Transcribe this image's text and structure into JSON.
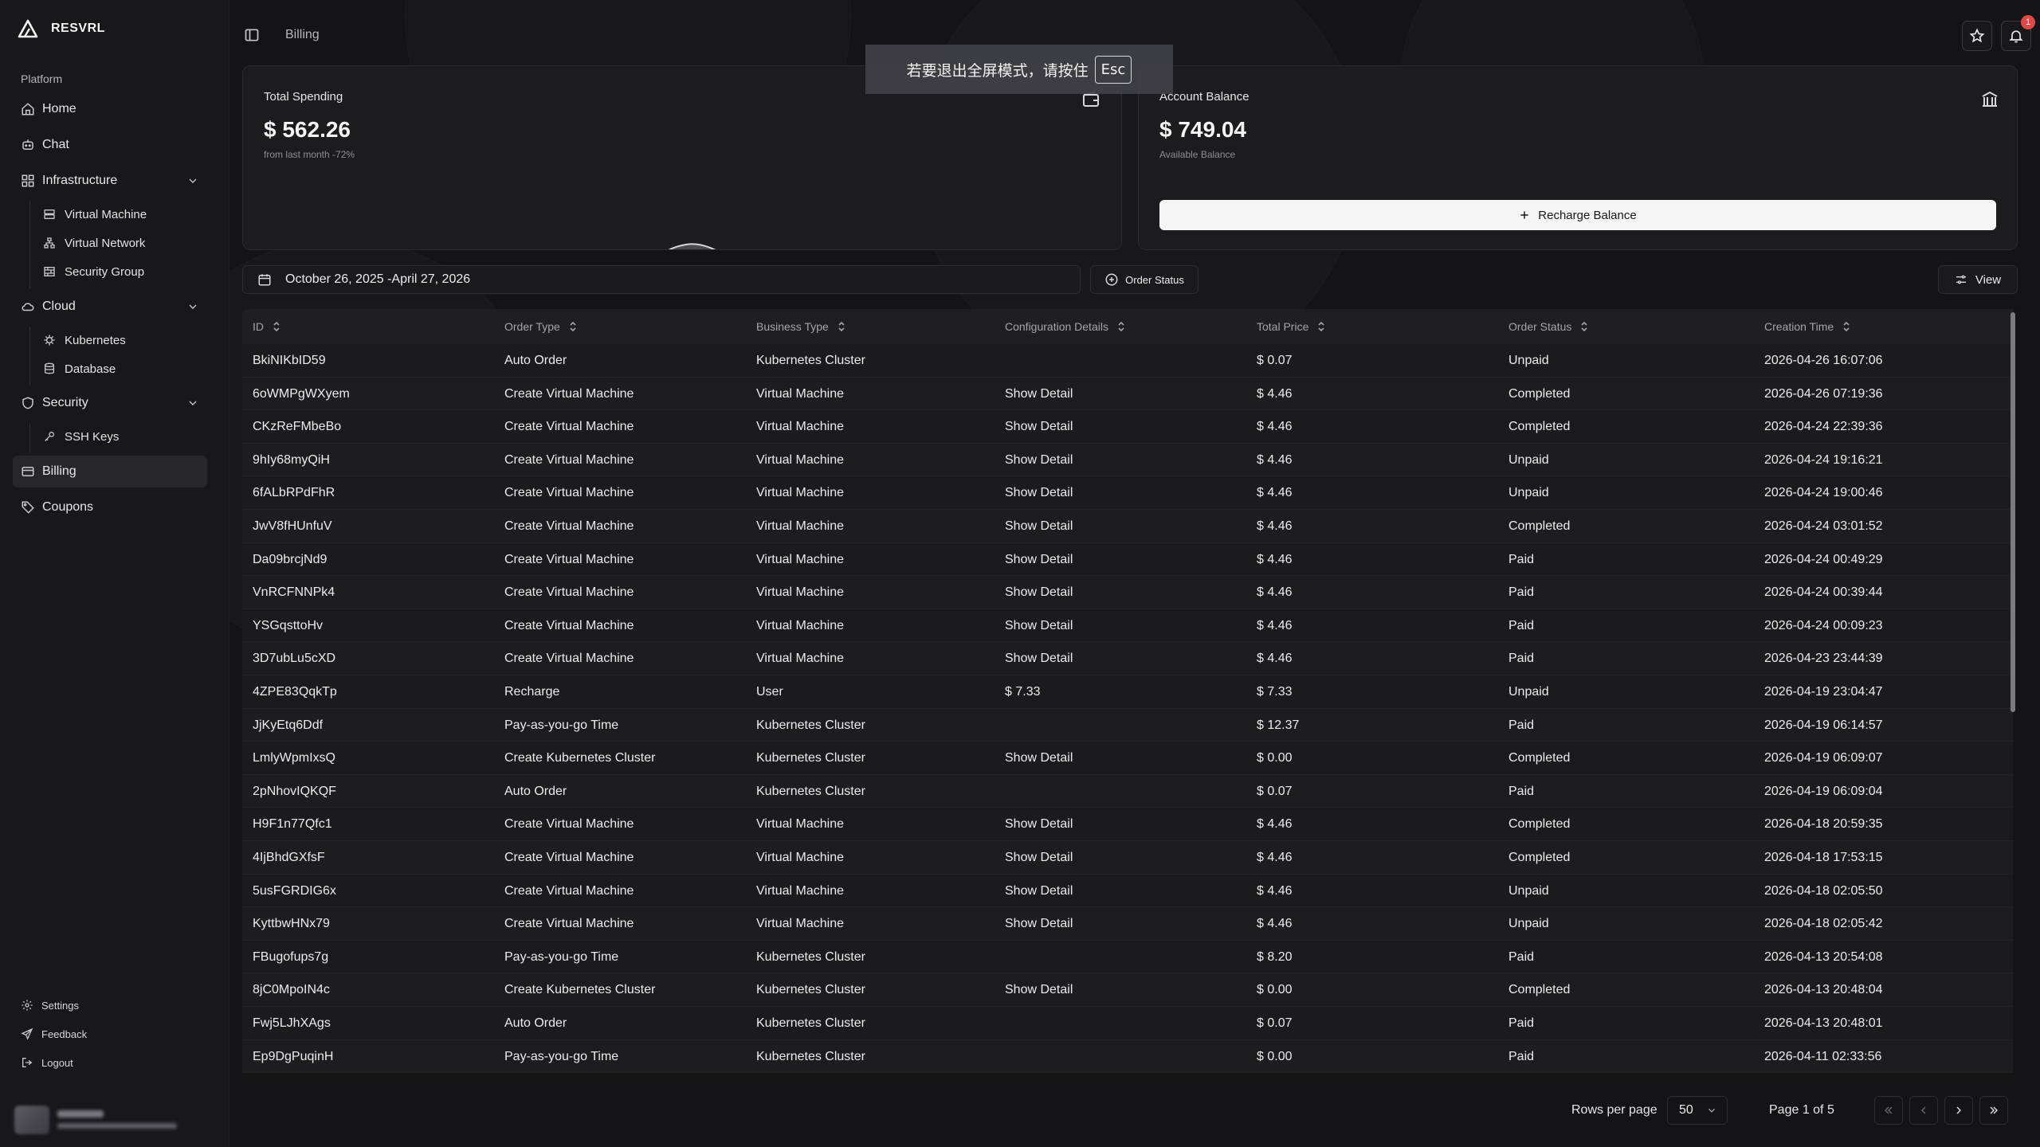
{
  "brand": {
    "name": "RESVRL"
  },
  "sidebar": {
    "section_label": "Platform",
    "home": "Home",
    "chat": "Chat",
    "infrastructure": {
      "label": "Infrastructure",
      "items": [
        "Virtual Machine",
        "Virtual Network",
        "Security Group"
      ]
    },
    "cloud": {
      "label": "Cloud",
      "items": [
        "Kubernetes",
        "Database"
      ]
    },
    "security": {
      "label": "Security",
      "items": [
        "SSH Keys"
      ]
    },
    "billing": "Billing",
    "coupons": "Coupons",
    "footer": {
      "settings": "Settings",
      "feedback": "Feedback",
      "logout": "Logout"
    }
  },
  "header": {
    "breadcrumb": "Billing",
    "notification_count": "1"
  },
  "fullscreen_toast": {
    "text": "若要退出全屏模式，请按住",
    "key": "Esc"
  },
  "total_spending": {
    "title": "Total Spending",
    "value": "$ 562.26",
    "sub": "from last month -72%"
  },
  "account_balance": {
    "title": "Account Balance",
    "value": "$ 749.04",
    "sub": "Available Balance",
    "recharge_label": "Recharge Balance"
  },
  "filters": {
    "date_range": "October 26, 2025 -April 27, 2026",
    "order_status": "Order Status",
    "view": "View"
  },
  "table": {
    "columns": [
      "ID",
      "Order Type",
      "Business Type",
      "Configuration Details",
      "Total Price",
      "Order Status",
      "Creation Time"
    ],
    "rows": [
      [
        "BkiNIKbID59",
        "Auto Order",
        "Kubernetes Cluster",
        "",
        "$ 0.07",
        "Unpaid",
        "2026-04-26 16:07:06"
      ],
      [
        "6oWMPgWXyem",
        "Create Virtual Machine",
        "Virtual Machine",
        "Show Detail",
        "$ 4.46",
        "Completed",
        "2026-04-26 07:19:36"
      ],
      [
        "CKzReFMbeBo",
        "Create Virtual Machine",
        "Virtual Machine",
        "Show Detail",
        "$ 4.46",
        "Completed",
        "2026-04-24 22:39:36"
      ],
      [
        "9hIy68myQiH",
        "Create Virtual Machine",
        "Virtual Machine",
        "Show Detail",
        "$ 4.46",
        "Unpaid",
        "2026-04-24 19:16:21"
      ],
      [
        "6fALbRPdFhR",
        "Create Virtual Machine",
        "Virtual Machine",
        "Show Detail",
        "$ 4.46",
        "Unpaid",
        "2026-04-24 19:00:46"
      ],
      [
        "JwV8fHUnfuV",
        "Create Virtual Machine",
        "Virtual Machine",
        "Show Detail",
        "$ 4.46",
        "Completed",
        "2026-04-24 03:01:52"
      ],
      [
        "Da09brcjNd9",
        "Create Virtual Machine",
        "Virtual Machine",
        "Show Detail",
        "$ 4.46",
        "Paid",
        "2026-04-24 00:49:29"
      ],
      [
        "VnRCFNNPk4",
        "Create Virtual Machine",
        "Virtual Machine",
        "Show Detail",
        "$ 4.46",
        "Paid",
        "2026-04-24 00:39:44"
      ],
      [
        "YSGqsttoHv",
        "Create Virtual Machine",
        "Virtual Machine",
        "Show Detail",
        "$ 4.46",
        "Paid",
        "2026-04-24 00:09:23"
      ],
      [
        "3D7ubLu5cXD",
        "Create Virtual Machine",
        "Virtual Machine",
        "Show Detail",
        "$ 4.46",
        "Paid",
        "2026-04-23 23:44:39"
      ],
      [
        "4ZPE83QqkTp",
        "Recharge",
        "User",
        "$ 7.33",
        "$ 7.33",
        "Unpaid",
        "2026-04-19 23:04:47"
      ],
      [
        "JjKyEtq6Ddf",
        "Pay-as-you-go Time",
        "Kubernetes Cluster",
        "",
        "$ 12.37",
        "Paid",
        "2026-04-19 06:14:57"
      ],
      [
        "LmlyWpmIxsQ",
        "Create Kubernetes Cluster",
        "Kubernetes Cluster",
        "Show Detail",
        "$ 0.00",
        "Completed",
        "2026-04-19 06:09:07"
      ],
      [
        "2pNhovIQKQF",
        "Auto Order",
        "Kubernetes Cluster",
        "",
        "$ 0.07",
        "Paid",
        "2026-04-19 06:09:04"
      ],
      [
        "H9F1n77Qfc1",
        "Create Virtual Machine",
        "Virtual Machine",
        "Show Detail",
        "$ 4.46",
        "Completed",
        "2026-04-18 20:59:35"
      ],
      [
        "4IjBhdGXfsF",
        "Create Virtual Machine",
        "Virtual Machine",
        "Show Detail",
        "$ 4.46",
        "Completed",
        "2026-04-18 17:53:15"
      ],
      [
        "5usFGRDIG6x",
        "Create Virtual Machine",
        "Virtual Machine",
        "Show Detail",
        "$ 4.46",
        "Unpaid",
        "2026-04-18 02:05:50"
      ],
      [
        "KyttbwHNx79",
        "Create Virtual Machine",
        "Virtual Machine",
        "Show Detail",
        "$ 4.46",
        "Unpaid",
        "2026-04-18 02:05:42"
      ],
      [
        "FBugofups7g",
        "Pay-as-you-go Time",
        "Kubernetes Cluster",
        "",
        "$ 8.20",
        "Paid",
        "2026-04-13 20:54:08"
      ],
      [
        "8jC0MpoIN4c",
        "Create Kubernetes Cluster",
        "Kubernetes Cluster",
        "Show Detail",
        "$ 0.00",
        "Completed",
        "2026-04-13 20:48:04"
      ],
      [
        "Fwj5LJhXAgs",
        "Auto Order",
        "Kubernetes Cluster",
        "",
        "$ 0.07",
        "Paid",
        "2026-04-13 20:48:01"
      ],
      [
        "Ep9DgPuqinH",
        "Pay-as-you-go Time",
        "Kubernetes Cluster",
        "",
        "$ 0.00",
        "Paid",
        "2026-04-11 02:33:56"
      ]
    ]
  },
  "pagination": {
    "rows_label": "Rows per page",
    "rows_value": "50",
    "page_label": "Page 1 of 5"
  },
  "icons": {
    "brand": "triangle-logo-icon",
    "home": "home-icon",
    "chat": "chat-icon",
    "infrastructure": "grid-icon",
    "virtual_machine": "server-icon",
    "virtual_network": "network-icon",
    "security_group": "firewall-icon",
    "cloud": "cloud-icon",
    "kubernetes": "helm-icon",
    "database": "database-icon",
    "security": "shield-icon",
    "ssh_keys": "key-icon",
    "billing": "credit-card-icon",
    "coupons": "tag-icon",
    "settings": "gear-icon",
    "feedback": "send-icon",
    "logout": "logout-icon",
    "star": "star-icon",
    "bell": "bell-icon"
  },
  "colors": {
    "background": "#141416",
    "sidebar": "#18181b",
    "card": "#1c1c1f",
    "accent_button": "#f5f5f6",
    "badge": "#e04848"
  }
}
